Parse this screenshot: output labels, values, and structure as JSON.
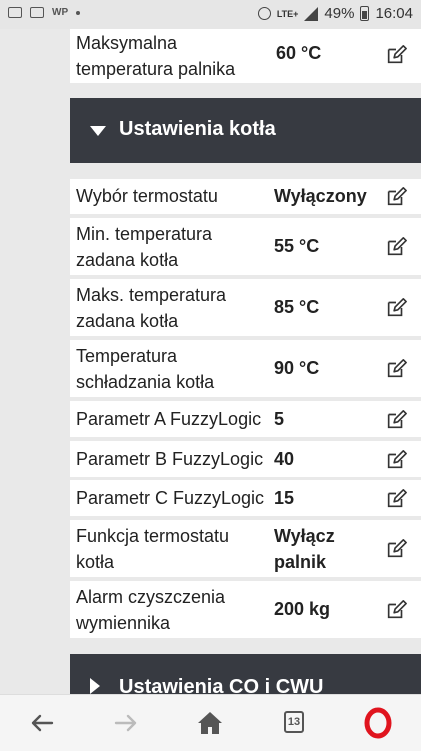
{
  "statusbar": {
    "battery": "49%",
    "time": "16:04",
    "network": "LTE+"
  },
  "top_row": {
    "label": "Maksymalna temperatura palnika",
    "value": "60 °C"
  },
  "section1": {
    "title": "Ustawienia kotła"
  },
  "rows": [
    {
      "label": "Wybór termostatu",
      "value": "Wyłączony"
    },
    {
      "label": "Min. temperatura zadana kotła",
      "value": "55 °C"
    },
    {
      "label": "Maks. temperatura zadana kotła",
      "value": "85 °C"
    },
    {
      "label": "Temperatura schładzania kotła",
      "value": "90 °C"
    },
    {
      "label": "Parametr A FuzzyLogic",
      "value": "5"
    },
    {
      "label": "Parametr B FuzzyLogic",
      "value": "40"
    },
    {
      "label": "Parametr C FuzzyLogic",
      "value": "15"
    },
    {
      "label": "Funkcja termostatu kotła",
      "value": "Wyłącz palnik"
    },
    {
      "label": "Alarm czyszczenia wymiennika",
      "value": "200 kg"
    }
  ],
  "section2": {
    "title": "Ustawienia CO i CWU"
  },
  "navbar": {
    "tabs_count": "13"
  },
  "colors": {
    "header_bg": "#373a41",
    "opera_red": "#e0141e",
    "page_bg": "#e9e9e9"
  }
}
